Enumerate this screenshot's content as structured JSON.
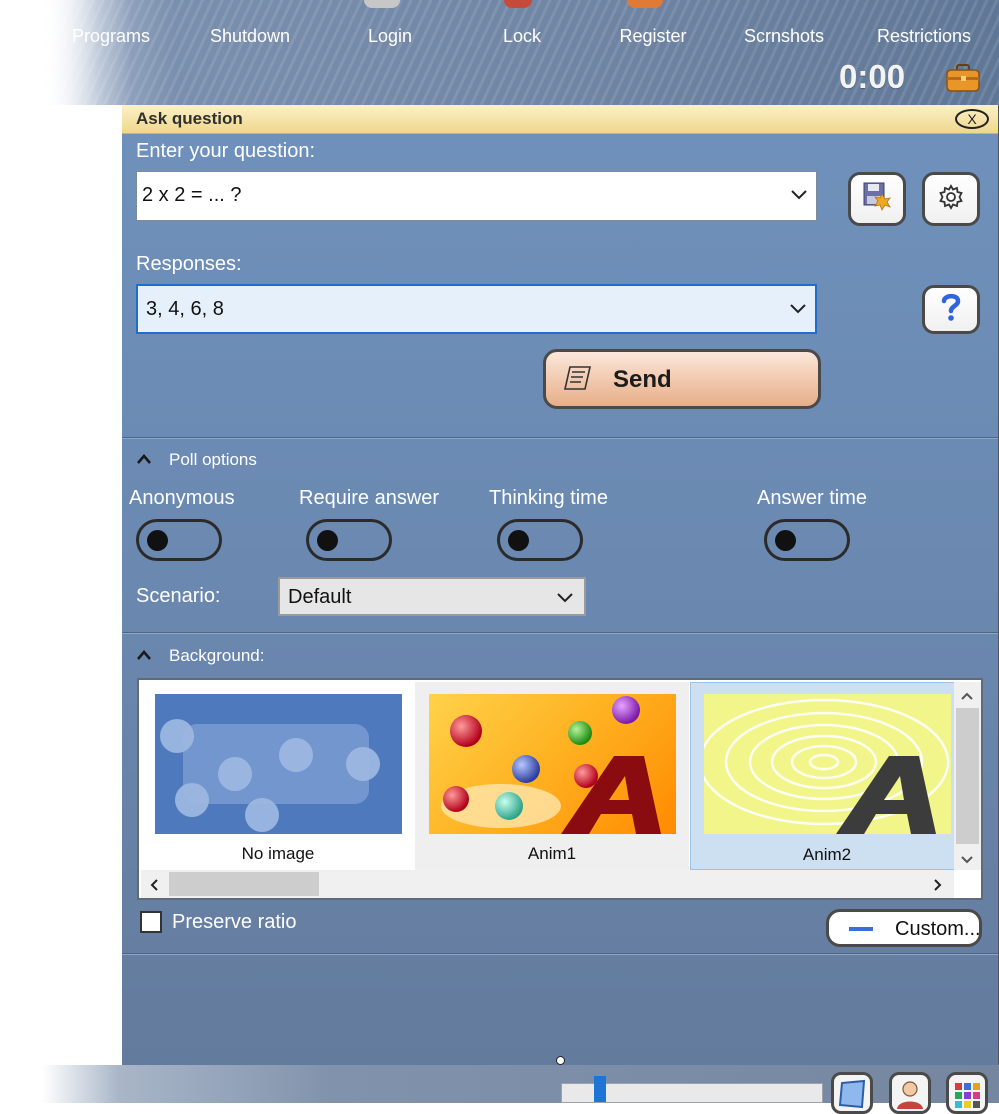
{
  "nav": {
    "items": [
      "Programs",
      "Shutdown",
      "Login",
      "Lock",
      "Register",
      "Scrnshots",
      "Restrictions"
    ],
    "timer": "0:00"
  },
  "dialog": {
    "title": "Ask question",
    "close_label": "X",
    "question_label": "Enter your question:",
    "question_value": "2 x 2 = ... ?",
    "responses_label": "Responses:",
    "responses_value": "3, 4, 6, 8",
    "send_label": "Send"
  },
  "poll": {
    "header": "Poll options",
    "toggles": [
      {
        "label": "Anonymous",
        "on": false
      },
      {
        "label": "Require answer",
        "on": false
      },
      {
        "label": "Thinking time",
        "on": false
      },
      {
        "label": "Answer time",
        "on": false
      }
    ],
    "scenario_label": "Scenario:",
    "scenario_value": "Default"
  },
  "background": {
    "header": "Background:",
    "items": [
      {
        "caption": "No image",
        "selected": false
      },
      {
        "caption": "Anim1",
        "selected": false
      },
      {
        "caption": "Anim2",
        "selected": true
      }
    ],
    "preserve_label": "Preserve ratio",
    "preserve_checked": false,
    "custom_label": "Custom..."
  },
  "colors": {
    "panel": "#6f91bb",
    "titlebar": "#efd78c",
    "send_button": "#f3cdb4",
    "selection": "#1f6ec8"
  },
  "icons": [
    "briefcase-icon",
    "save-settings-icon",
    "gear-icon",
    "help-icon",
    "send-icon",
    "chevron-down-icon",
    "chevron-up-icon"
  ]
}
